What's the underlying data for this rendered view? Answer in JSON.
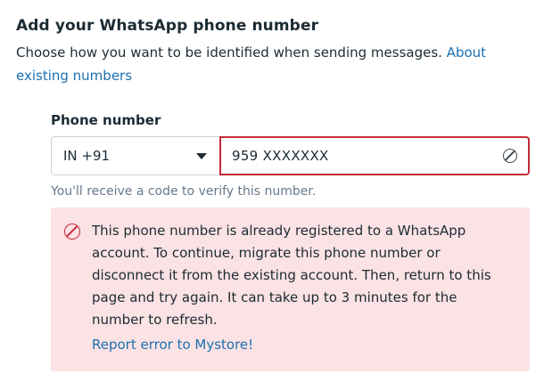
{
  "header": {
    "title": "Add your WhatsApp phone number",
    "subtitle": "Choose how you want to be identified when sending messages.",
    "about_link": "About existing numbers"
  },
  "form": {
    "phone_label": "Phone number",
    "country_code": "IN +91",
    "phone_value": "959 XXXXXXX",
    "hint": "You'll receive a code to verify this number."
  },
  "error": {
    "message": "This phone number is already registered to a WhatsApp account. To continue, migrate this phone number or disconnect it from the existing account. Then, return to this page and try again. It can take up to 3 minutes for the number to refresh.",
    "report_link": "Report error to Mystore!"
  },
  "colors": {
    "link": "#1b6fb0",
    "error_border": "#c52a3a",
    "error_background": "#fbe2e4"
  },
  "icons": {
    "country_dropdown": "caret-down-icon",
    "input_error": "error-circle-icon",
    "alert": "error-circle-icon"
  }
}
